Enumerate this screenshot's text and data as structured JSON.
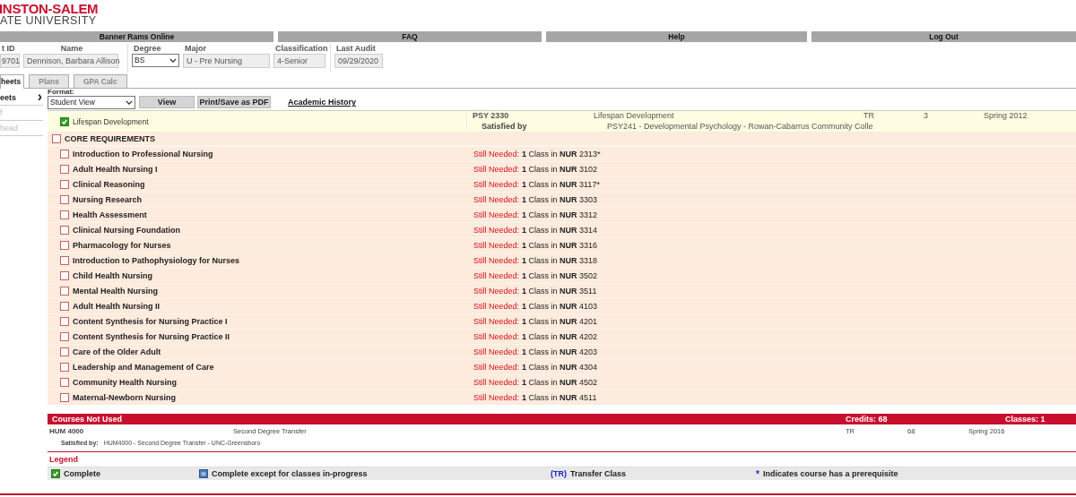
{
  "logo": {
    "line1": "INSTON-SALEM",
    "line2": "ATE UNIVERSITY"
  },
  "nav": [
    "Banner Rams Online",
    "FAQ",
    "Help",
    "Log Out"
  ],
  "student": {
    "fields": [
      {
        "label": "t ID",
        "value": "9701",
        "kind": "text"
      },
      {
        "label": "Name",
        "value": "Dennison, Barbara Allison",
        "kind": "text"
      },
      {
        "label": "Degree",
        "value": "BS",
        "kind": "select"
      },
      {
        "label": "Major",
        "value": "U - Pre Nursing",
        "kind": "text"
      },
      {
        "label": "Classification",
        "value": "4-Senior",
        "kind": "text"
      },
      {
        "label": "Last Audit",
        "value": "09/29/2020",
        "kind": "text"
      }
    ]
  },
  "tabs": [
    {
      "label": "heets",
      "selected": true
    },
    {
      "label": "Plans",
      "selected": false
    },
    {
      "label": "GPA Calc",
      "selected": false
    }
  ],
  "sidebar": {
    "items": [
      {
        "label": "eets",
        "disabled": false,
        "arrow": "›"
      },
      {
        "label": "f",
        "disabled": true
      },
      {
        "label": "head",
        "disabled": true
      }
    ]
  },
  "toolbar": {
    "format_label": "Format:",
    "format_value": "Student View",
    "buttons": [
      "View",
      "Print/Save as PDF"
    ],
    "link": "Academic History"
  },
  "completed_row": {
    "title": "Lifespan Development",
    "complete": true,
    "course": "PSY 2330",
    "course_title": "Lifespan Development",
    "satisfied_label": "Satisfied by",
    "satisfied_text": "PSY241 - Developmental Psychology - Rowan-Cabarrus Community Colle",
    "grade": "TR",
    "credits": "3",
    "term": "Spring 2012"
  },
  "block": {
    "title": "CORE REQUIREMENTS",
    "complete": false,
    "requirements": [
      {
        "title": "Introduction to Professional Nursing",
        "complete": false,
        "status": "Still Needed:",
        "need": "**1** Class in **NUR** 2313*"
      },
      {
        "title": "Adult Health Nursing I",
        "complete": false,
        "status": "Still Needed:",
        "need": "**1** Class in **NUR** 3102"
      },
      {
        "title": "Clinical Reasoning",
        "complete": false,
        "status": "Still Needed:",
        "need": "**1** Class in **NUR** 3117*"
      },
      {
        "title": "Nursing Research",
        "complete": false,
        "status": "Still Needed:",
        "need": "**1** Class in **NUR** 3303"
      },
      {
        "title": "Health Assessment",
        "complete": false,
        "status": "Still Needed:",
        "need": "**1** Class in **NUR** 3312"
      },
      {
        "title": "Clinical Nursing Foundation",
        "complete": false,
        "status": "Still Needed:",
        "need": "**1** Class in **NUR** 3314"
      },
      {
        "title": "Pharmacology for Nurses",
        "complete": false,
        "status": "Still Needed:",
        "need": "**1** Class in **NUR** 3316"
      },
      {
        "title": "Introduction to Pathophysiology for Nurses",
        "complete": false,
        "status": "Still Needed:",
        "need": "**1** Class in **NUR** 3318"
      },
      {
        "title": "Child Health Nursing",
        "complete": false,
        "status": "Still Needed:",
        "need": "**1** Class in **NUR** 3502"
      },
      {
        "title": "Mental Health Nursing",
        "complete": false,
        "status": "Still Needed:",
        "need": "**1** Class in **NUR** 3511"
      },
      {
        "title": "Adult Health Nursing II",
        "complete": false,
        "status": "Still Needed:",
        "need": "**1** Class in **NUR** 4103"
      },
      {
        "title": "Content Synthesis for Nursing Practice I",
        "complete": false,
        "status": "Still Needed:",
        "need": "**1** Class in **NUR** 4201"
      },
      {
        "title": "Content Synthesis for Nursing Practice II",
        "complete": false,
        "status": "Still Needed:",
        "need": "**1** Class in **NUR** 4202"
      },
      {
        "title": "Care of the Older Adult",
        "complete": false,
        "status": "Still Needed:",
        "need": "**1** Class in **NUR** 4203"
      },
      {
        "title": "Leadership and Management of Care",
        "complete": false,
        "status": "Still Needed:",
        "need": "**1** Class in **NUR** 4304"
      },
      {
        "title": "Community Health Nursing",
        "complete": false,
        "status": "Still Needed:",
        "need": "**1** Class in **NUR** 4502"
      },
      {
        "title": "Maternal-Newborn Nursing",
        "complete": false,
        "status": "Still Needed:",
        "need": "**1** Class in **NUR** 4511"
      }
    ]
  },
  "not_used": {
    "title": "Courses Not Used",
    "credits": "Credits:  68",
    "classes": "Classes:  1",
    "course": "HUM 4000",
    "course_title": "Second Degree Transfer",
    "grade": "TR",
    "credits_value": "68",
    "term": "Spring 2016",
    "satisfied_label": "Satisfied by:",
    "satisfied_text": "HUM4000 - Second Degree Transfer - UNC-Greensboro"
  },
  "legend": {
    "title": "Legend",
    "items": [
      {
        "kind": "complete",
        "label": "Complete"
      },
      {
        "kind": "in_progress",
        "label": "Complete except for classes in-progress"
      },
      {
        "kind": "transfer",
        "mark": "(TR)",
        "label": "Transfer Class"
      },
      {
        "kind": "prereq",
        "mark": "*",
        "label": "Indicates course has a prerequisite"
      }
    ]
  }
}
